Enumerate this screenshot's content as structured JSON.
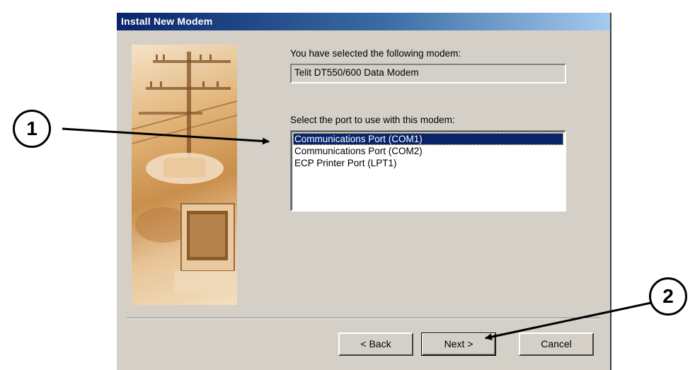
{
  "window": {
    "title": "Install New Modem"
  },
  "main": {
    "selected_modem_label": "You have selected the following modem:",
    "selected_modem_value": "Telit DT550/600 Data Modem",
    "port_label": "Select the port to use with this modem:",
    "ports": [
      "Communications Port (COM1)",
      "Communications Port (COM2)",
      "ECP Printer Port (LPT1)"
    ],
    "selected_port_index": 0
  },
  "buttons": {
    "back": "< Back",
    "next": "Next >",
    "cancel": "Cancel"
  },
  "callouts": {
    "first": "1",
    "second": "2"
  },
  "colors": {
    "title_bar": "#0a246a",
    "dialog_face": "#d4d0c8",
    "selection": "#0a246a"
  }
}
